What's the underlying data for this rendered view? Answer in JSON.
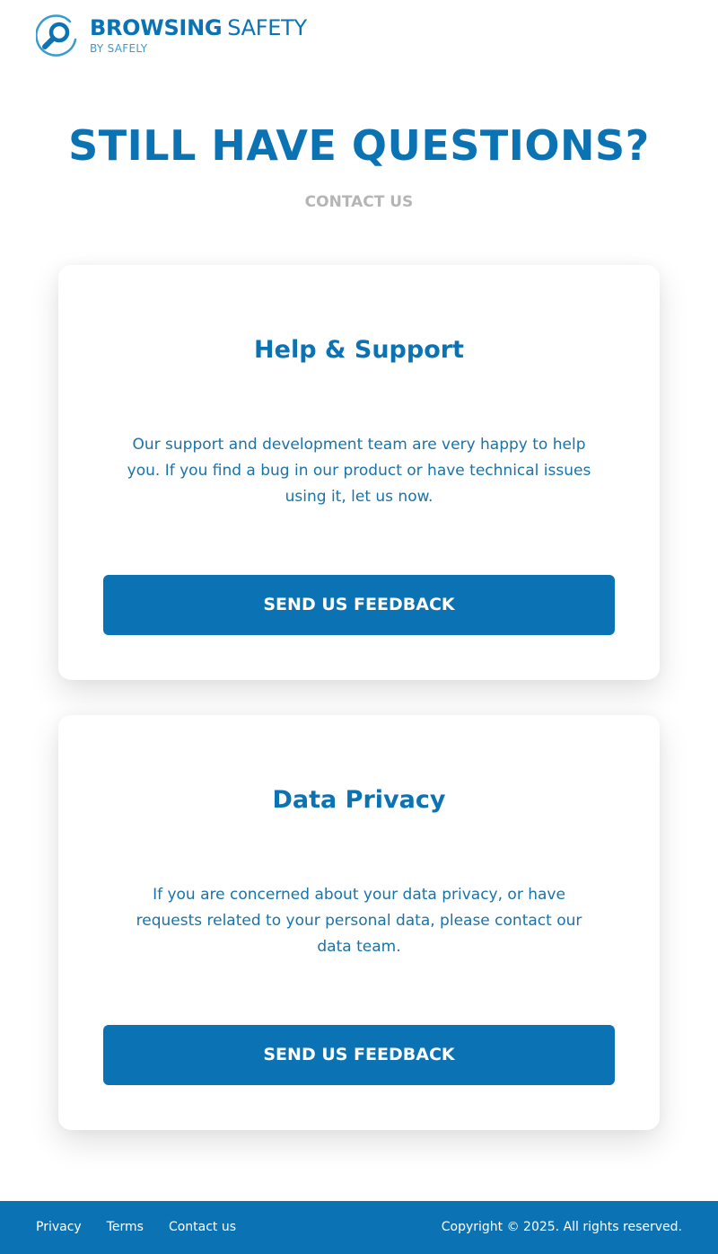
{
  "header": {
    "logo_title_strong": "BROWSING",
    "logo_title_light": "SAFETY",
    "logo_subtitle": "BY SAFELY",
    "logo_icon": "magnifier-icon"
  },
  "hero": {
    "title": "STILL HAVE QUESTIONS?",
    "subtitle": "CONTACT US"
  },
  "cards": [
    {
      "title": "Help & Support",
      "body": "Our support and development team are very happy to help you. If you find a bug in our product or have technical issues using it, let us now.",
      "button_label": "SEND US FEEDBACK"
    },
    {
      "title": "Data Privacy",
      "body": "If you are concerned about your data privacy, or have requests related to your personal data, please contact our data team.",
      "button_label": "SEND US FEEDBACK"
    }
  ],
  "footer": {
    "links": [
      "Privacy",
      "Terms",
      "Contact us"
    ],
    "copyright": "Copyright © 2025. All rights reserved."
  },
  "colors": {
    "brand": "#0b73b3",
    "logo_sub": "#3a9bd0",
    "muted": "#b5b5b5",
    "background": "#ffffff"
  }
}
